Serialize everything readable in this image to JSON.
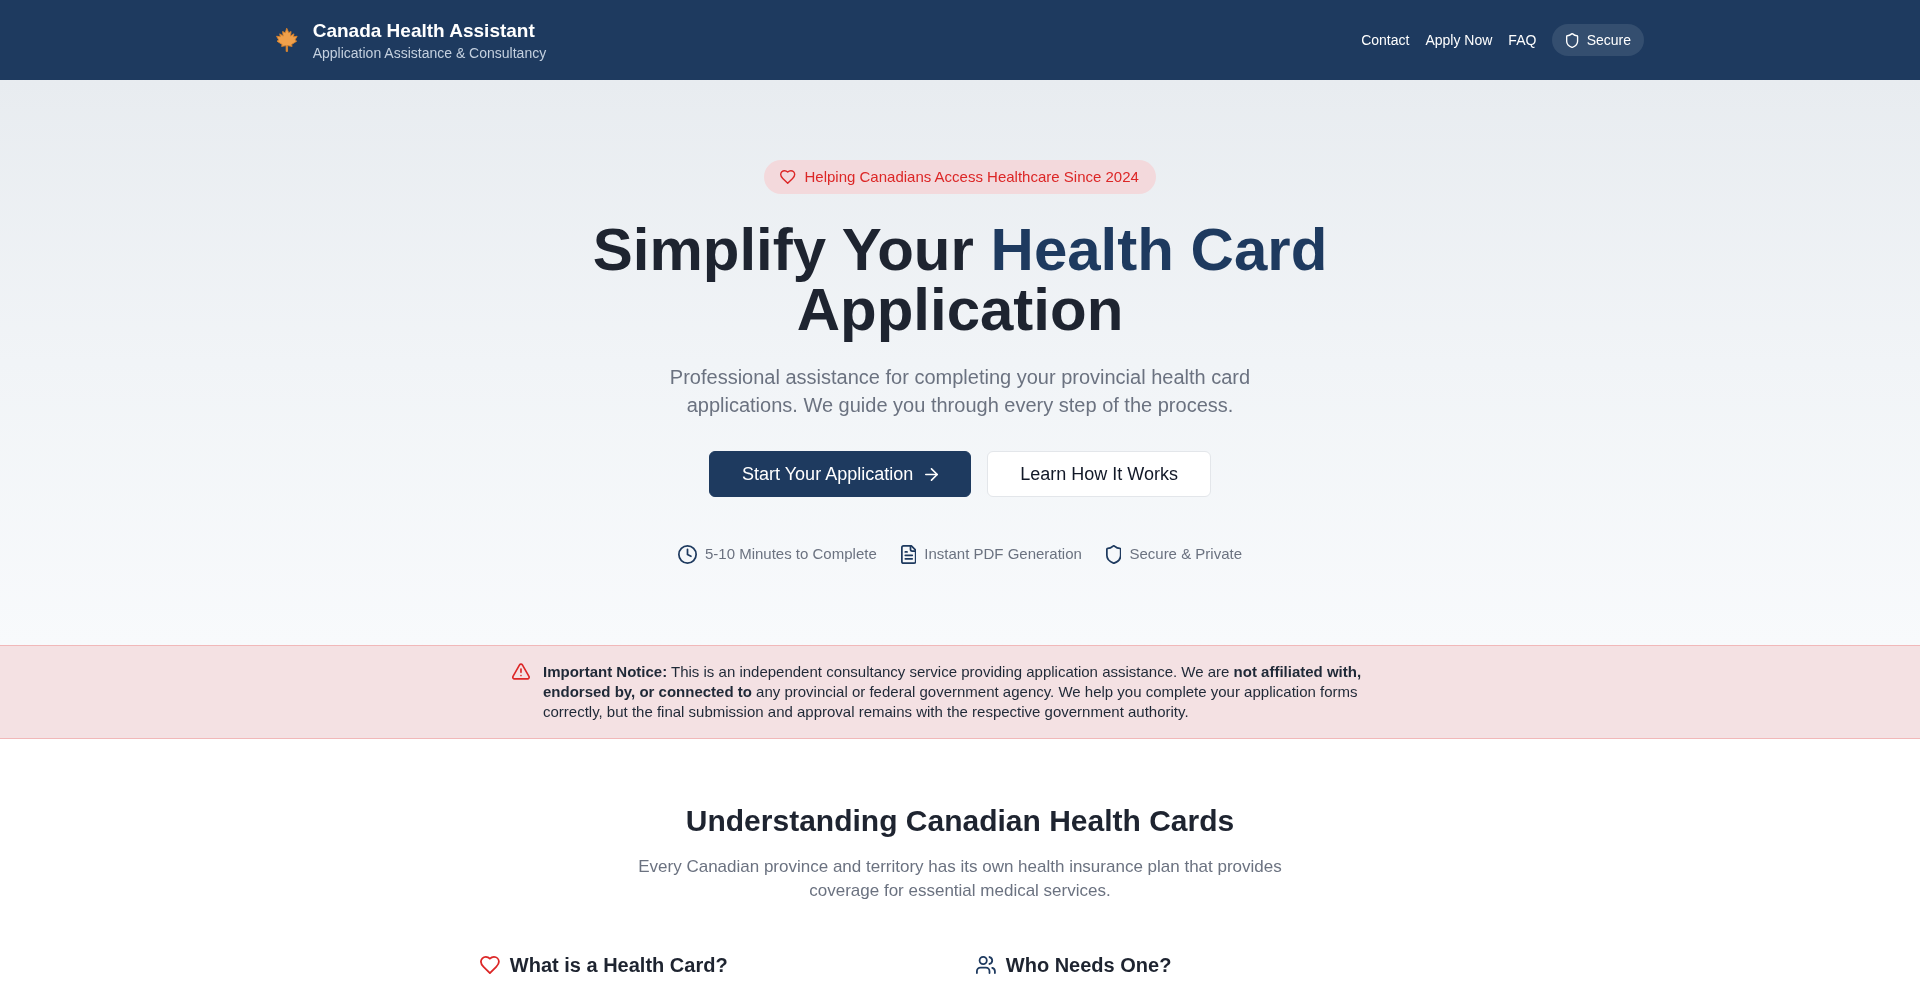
{
  "header": {
    "title": "Canada Health Assistant",
    "subtitle": "Application Assistance & Consultancy",
    "nav_links": [
      "Contact",
      "Apply Now",
      "FAQ"
    ],
    "secure_badge": "Secure"
  },
  "hero": {
    "badge": "Helping Canadians Access Healthcare Since 2024",
    "title": [
      {
        "text": "Simplify Your",
        "highlight": false
      },
      {
        "text": "Health Card",
        "highlight": true
      },
      {
        "text": "Application",
        "highlight": false
      }
    ],
    "subtitle": "Professional assistance for completing your provincial health card applications. We guide you through every step of the process.",
    "buttons": [
      {
        "label": "Start Your Application",
        "kind": "primary"
      },
      {
        "label": "Learn How It Works",
        "kind": "secondary"
      }
    ],
    "features": [
      "5-10 Minutes to Complete",
      "Instant PDF Generation",
      "Secure & Private"
    ]
  },
  "notice": {
    "text": "**Important Notice:** This is an independent consultancy service providing application assistance. We are **not affiliated with, endorsed by, or connected to** any provincial or federal government agency. We help you complete your application forms correctly, but the final submission and approval remains with the respective government authority."
  },
  "info_section": {
    "heading": "Understanding Canadian Health Cards",
    "description": "Every Canadian province and territory has its own health insurance plan that provides coverage for essential medical services.",
    "cards": [
      {
        "title": "What is a Health Card?"
      },
      {
        "title": "Who Needs One?"
      }
    ]
  }
}
